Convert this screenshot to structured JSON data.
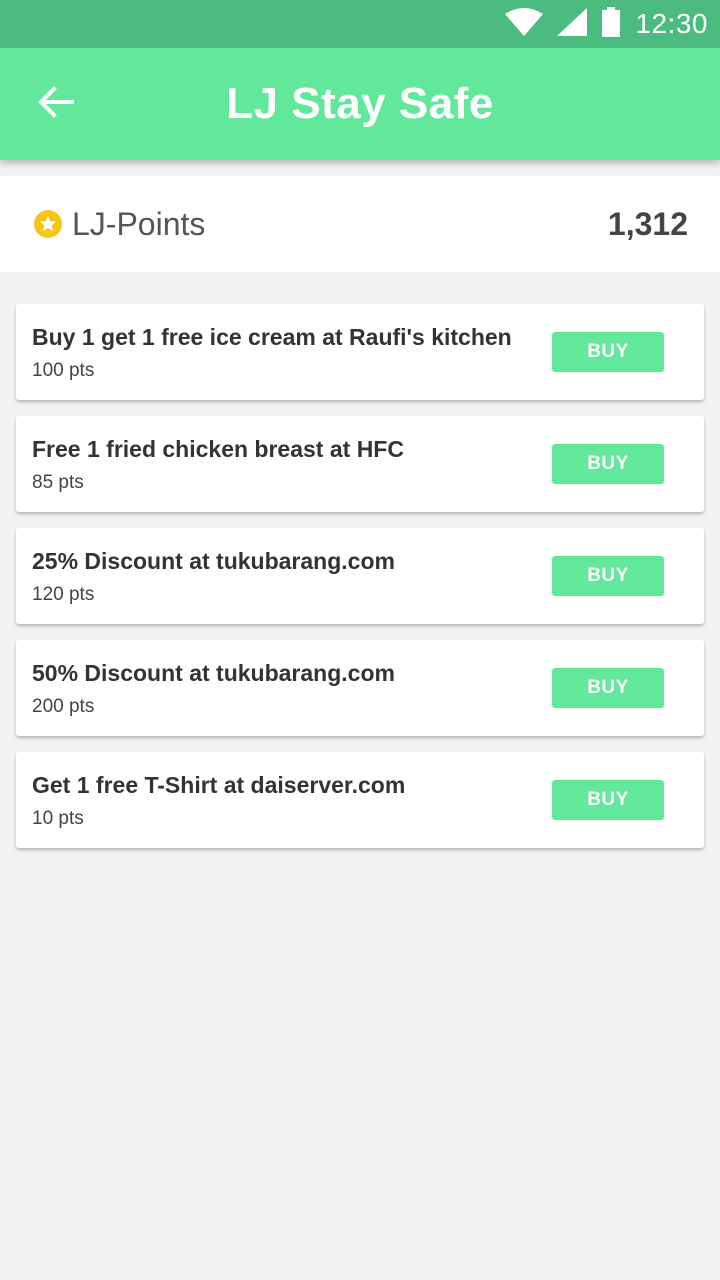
{
  "status_bar": {
    "time": "12:30",
    "icons": [
      "wifi-icon",
      "cell-signal-icon",
      "battery-icon"
    ]
  },
  "app_bar": {
    "title": "LJ Stay Safe",
    "back_icon": "arrow-left-icon"
  },
  "points": {
    "icon": "star-icon",
    "label": "LJ-Points",
    "value": "1,312"
  },
  "rewards": [
    {
      "title": "Buy 1 get 1 free ice cream at Raufi's kitchen",
      "cost": "100 pts",
      "button": "BUY"
    },
    {
      "title": "Free 1 fried chicken breast at HFC",
      "cost": "85 pts",
      "button": "BUY"
    },
    {
      "title": "25% Discount at tukubarang.com",
      "cost": "120 pts",
      "button": "BUY"
    },
    {
      "title": "50% Discount at tukubarang.com",
      "cost": "200 pts",
      "button": "BUY"
    },
    {
      "title": "Get 1 free T-Shirt at daiserver.com",
      "cost": "10 pts",
      "button": "BUY"
    }
  ],
  "colors": {
    "status_bar": "#4cbb7f",
    "primary": "#61e89a",
    "star": "#f5c518",
    "background": "#f2f2f2"
  }
}
